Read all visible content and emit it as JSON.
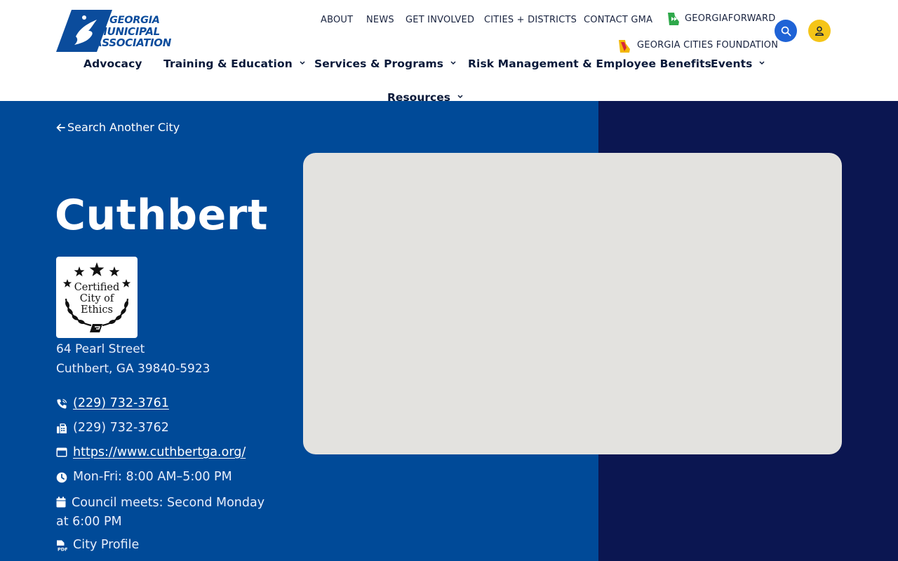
{
  "logo": {
    "line1": "GEORGIA",
    "line2": "MUNICIPAL",
    "line3": "ASSOCIATION"
  },
  "utility_nav": {
    "about": "ABOUT",
    "news": "NEWS",
    "get_involved": "GET INVOLVED",
    "cities_districts": "CITIES + DISTRICTS",
    "contact": "CONTACT GMA",
    "georgia_forward": "GEORGIAFORWARD",
    "foundation": "GEORGIA CITIES FOUNDATION"
  },
  "main_nav": {
    "advocacy": "Advocacy",
    "training": "Training & Education",
    "services": "Services & Programs",
    "risk": "Risk Management & Employee Benefits",
    "events": "Events",
    "resources": "Resources"
  },
  "city": {
    "back_label": "Search Another City",
    "name": "Cuthbert",
    "badge": {
      "line1": "Certified",
      "line2": "City of",
      "line3": "Ethics"
    },
    "address_line1": "64 Pearl Street",
    "address_line2": "Cuthbert, GA 39840-5923",
    "phone": "(229) 732-3761",
    "fax": "(229) 732-3762",
    "website": "https://www.cuthbertga.org/",
    "hours": "Mon-Fri: 8:00 AM–5:00 PM",
    "council": "Council meets: Second Monday at 6:00 PM",
    "profile": "City Profile"
  },
  "colors": {
    "brand_blue": "#004a98",
    "navy": "#0b1651",
    "search_button": "#1f63d6",
    "account_button": "#f5c518",
    "map_placeholder": "#e3e2df"
  },
  "icons": {
    "search": "search-icon",
    "account": "user-icon",
    "back": "arrow-left-icon",
    "phone": "phone-icon",
    "fax": "fax-icon",
    "website": "browser-icon",
    "hours": "clock-icon",
    "council": "calendar-icon",
    "profile": "pdf-icon"
  }
}
